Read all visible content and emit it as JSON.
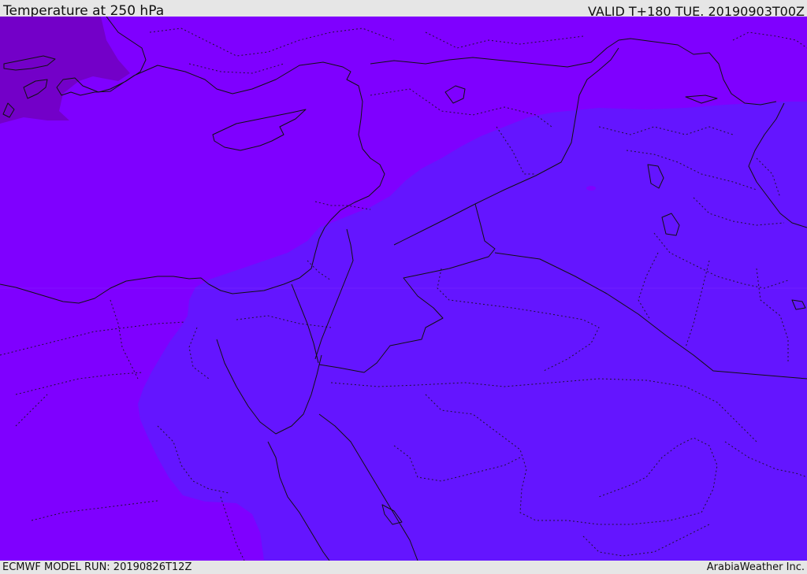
{
  "header": {
    "title": "Temperature at 250 hPa",
    "valid": "VALID T+180 TUE. 20190903T00Z"
  },
  "footer": {
    "model_run": "ECMWF MODEL RUN: 20190826T12Z",
    "credit": "ArabiaWeather Inc."
  },
  "colors": {
    "band_coldest": "#7300c8",
    "band_cold": "#7f00ff",
    "band_mild": "#6415ff",
    "frame": "#e6e6e6",
    "boundary": "#111111"
  }
}
